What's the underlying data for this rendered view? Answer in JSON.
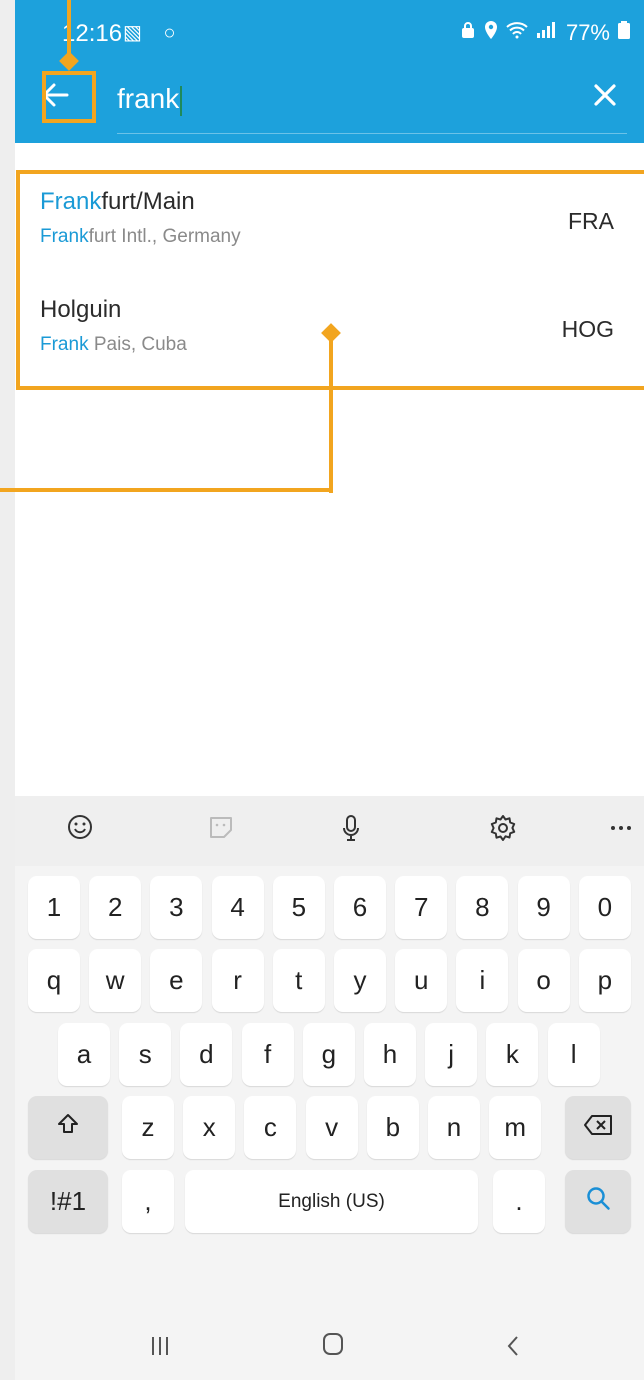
{
  "status_bar": {
    "time": "12:16",
    "left_icons": "▧ ○",
    "battery": "77%"
  },
  "search": {
    "query": "frank"
  },
  "results": [
    {
      "city": "Frankfurt/Main",
      "city_match": "Frank",
      "city_rest": "furt/Main",
      "detail_match": "Frank",
      "detail_rest": "furt Intl., Germany",
      "code": "FRA"
    },
    {
      "city": "Holguin",
      "city_match": "",
      "city_rest": "Holguin",
      "detail_match": "Frank",
      "detail_rest": " Pais, Cuba",
      "code": "HOG"
    }
  ],
  "keyboard": {
    "toolbar_icons": [
      "emoji-icon",
      "sticker-icon",
      "microphone-icon",
      "settings-icon",
      "more-icon"
    ],
    "number_row": [
      "1",
      "2",
      "3",
      "4",
      "5",
      "6",
      "7",
      "8",
      "9",
      "0"
    ],
    "row1": [
      "q",
      "w",
      "e",
      "r",
      "t",
      "y",
      "u",
      "i",
      "o",
      "p"
    ],
    "row2": [
      "a",
      "s",
      "d",
      "f",
      "g",
      "h",
      "j",
      "k",
      "l"
    ],
    "row3": [
      "z",
      "x",
      "c",
      "v",
      "b",
      "n",
      "m"
    ],
    "symbols_label": "!#1",
    "comma": ",",
    "space_label": "English (US)",
    "period": "."
  },
  "colors": {
    "app_bar": "#1da1dc",
    "highlight": "#1a9ad6",
    "annotation": "#f2a51f"
  }
}
